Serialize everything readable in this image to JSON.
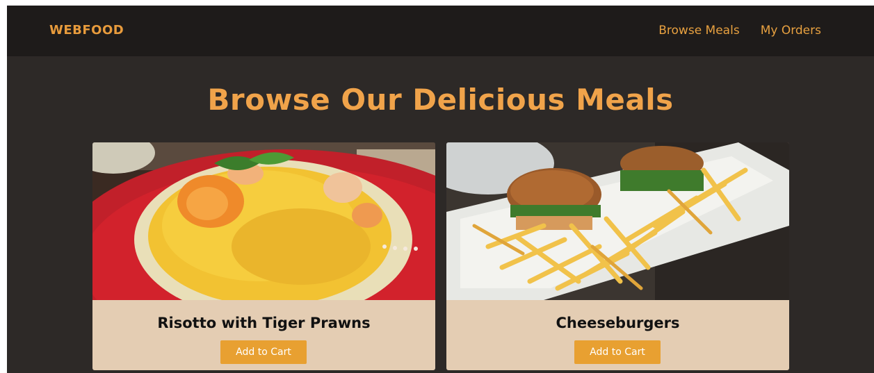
{
  "header": {
    "brand": "WEBFOOD",
    "nav": [
      {
        "label": "Browse Meals"
      },
      {
        "label": "My Orders"
      }
    ]
  },
  "main": {
    "title": "Browse Our Delicious Meals",
    "meals": [
      {
        "name": "Risotto with Tiger Prawns",
        "button_label": "Add to Cart"
      },
      {
        "name": "Cheeseburgers",
        "button_label": "Add to Cart"
      }
    ]
  },
  "colors": {
    "background": "#2d2927",
    "navbar": "#1e1b1a",
    "accent": "#e89b3c",
    "card": "#e4cdb3",
    "button": "#e8a031"
  }
}
